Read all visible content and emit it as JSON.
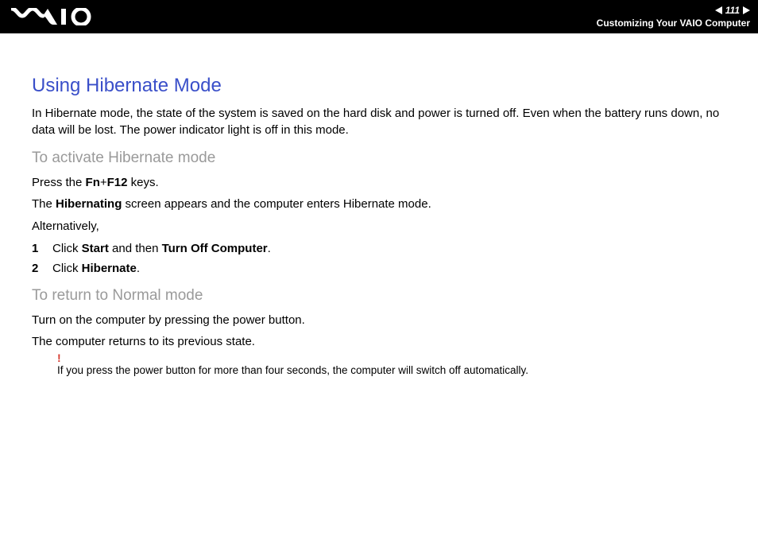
{
  "header": {
    "page_number": "111",
    "section_title": "Customizing Your VAIO Computer"
  },
  "main": {
    "title": "Using Hibernate Mode",
    "intro": "In Hibernate mode, the state of the system is saved on the hard disk and power is turned off. Even when the battery runs down, no data will be lost. The power indicator light is off in this mode.",
    "section_a": {
      "heading": "To activate Hibernate mode",
      "line1_pre": "Press the ",
      "line1_key1": "Fn",
      "line1_plus": "+",
      "line1_key2": "F12",
      "line1_post": " keys.",
      "line2_pre": "The ",
      "line2_bold": "Hibernating",
      "line2_post": " screen appears and the computer enters Hibernate mode.",
      "line3": "Alternatively,",
      "steps": [
        {
          "num": "1",
          "pre": "Click ",
          "b1": "Start",
          "mid": " and then ",
          "b2": "Turn Off Computer",
          "post": "."
        },
        {
          "num": "2",
          "pre": "Click ",
          "b1": "Hibernate",
          "mid": "",
          "b2": "",
          "post": "."
        }
      ]
    },
    "section_b": {
      "heading": "To return to Normal mode",
      "line1": "Turn on the computer by pressing the power button.",
      "line2": "The computer returns to its previous state."
    },
    "note": {
      "mark": "!",
      "text": "If you press the power button for more than four seconds, the computer will switch off automatically."
    }
  }
}
